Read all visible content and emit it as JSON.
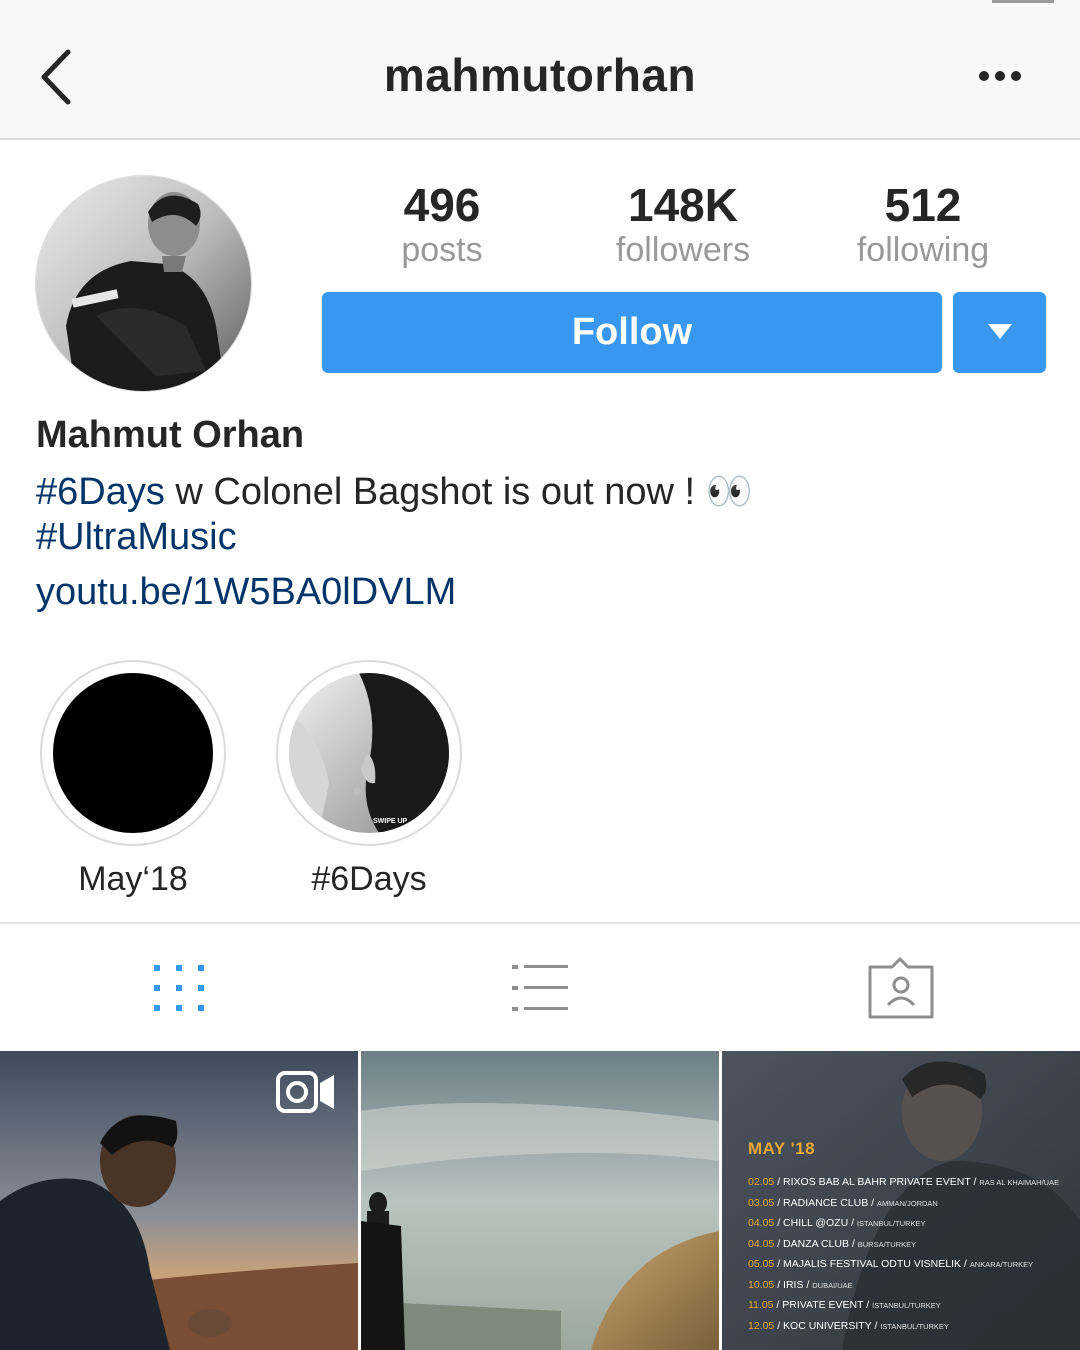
{
  "header": {
    "username": "mahmutorhan"
  },
  "stats": {
    "posts_value": "496",
    "posts_label": "posts",
    "followers_value": "148K",
    "followers_label": "followers",
    "following_value": "512",
    "following_label": "following"
  },
  "actions": {
    "follow_label": "Follow"
  },
  "profile": {
    "display_name": "Mahmut Orhan",
    "bio_hashtag_1": "#6Days",
    "bio_text_1": " w Colonel Bagshot is out now ! ",
    "bio_emoji": "👀",
    "bio_hashtag_2": "#UltraMusic",
    "bio_link": "youtu.be/1W5BA0lDVLM"
  },
  "highlights": [
    {
      "label": "May‘18"
    },
    {
      "label": "#6Days",
      "image_text": "SWIPE UP"
    }
  ],
  "tabs": [
    "grid-icon",
    "list-icon",
    "tagged-icon"
  ],
  "grid": {
    "post_3": {
      "title": "MAY '18",
      "events": [
        {
          "date": "02.05",
          "name": "RIXOS BAB AL BAHR PRIVATE EVENT",
          "location": "RAS AL KHAIMAH/UAE"
        },
        {
          "date": "03.05",
          "name": "RADIANCE CLUB",
          "location": "AMMAN/JORDAN"
        },
        {
          "date": "04.05",
          "name": "CHILL @OZU",
          "location": "ISTANBUL/TURKEY"
        },
        {
          "date": "04.05",
          "name": "DANZA CLUB",
          "location": "BURSA/TURKEY"
        },
        {
          "date": "05.05",
          "name": "MAJALIS FESTIVAL ODTU VISNELIK",
          "location": "ANKARA/TURKEY"
        },
        {
          "date": "10.05",
          "name": "IRIS",
          "location": "DUBAI/UAE"
        },
        {
          "date": "11.05",
          "name": "PRIVATE EVENT",
          "location": "ISTANBUL/TURKEY"
        },
        {
          "date": "12.05",
          "name": "KOC UNIVERSITY",
          "location": "ISTANBUL/TURKEY"
        }
      ]
    }
  },
  "colors": {
    "follow_blue": "#3897f0",
    "link_blue": "#003569",
    "tour_accent": "#e8a930"
  }
}
